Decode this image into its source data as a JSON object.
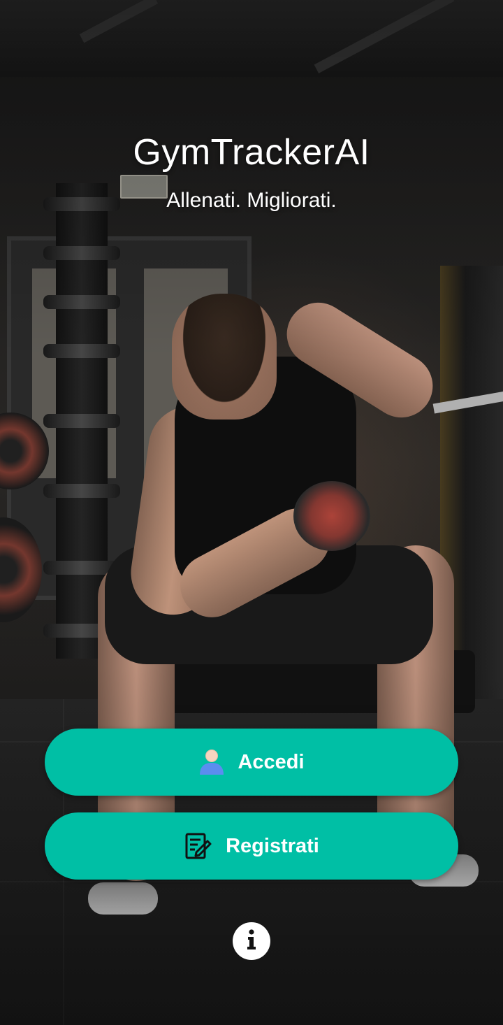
{
  "app": {
    "title": "GymTrackerAI",
    "subtitle": "Allenati. Migliorati."
  },
  "actions": {
    "login_label": "Accedi",
    "login_icon": "user-icon",
    "register_label": "Registrati",
    "register_icon": "edit-form-icon",
    "info_icon": "info-icon"
  },
  "theme": {
    "accent": "#00BFA5",
    "text": "#FFFFFF"
  }
}
